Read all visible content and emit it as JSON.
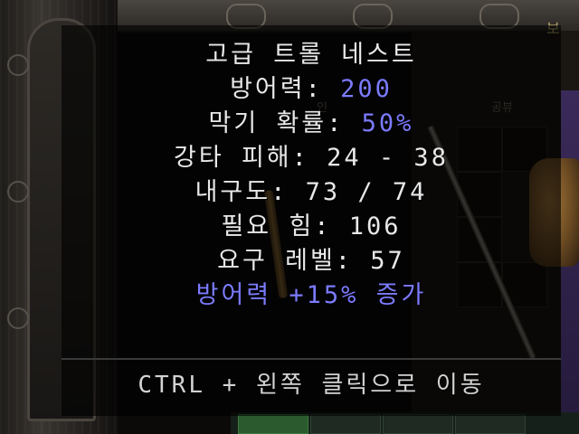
{
  "background": {
    "top_right_label": "보",
    "tab_left": "인",
    "tab_right": "공뷰"
  },
  "tooltip": {
    "item_name": "고급 트롤 네스트",
    "defense_label": "방어력: ",
    "defense_value": "200",
    "block_label": "막기 확률: ",
    "block_value": "50%",
    "smite_damage": "강타 피해: 24 - 38",
    "durability": "내구도: 73 / 74",
    "required_strength": "필요 힘: 106",
    "required_level": "요구 레벨: 57",
    "magic_property": "방어력 +15% 증가",
    "footer_hint": "CTRL + 왼쪽 클릭으로 이동"
  },
  "colors": {
    "text_white": "#e8e8e8",
    "text_blue": "#7b7bff",
    "tooltip_bg": "rgba(0,0,0,0.62)"
  }
}
